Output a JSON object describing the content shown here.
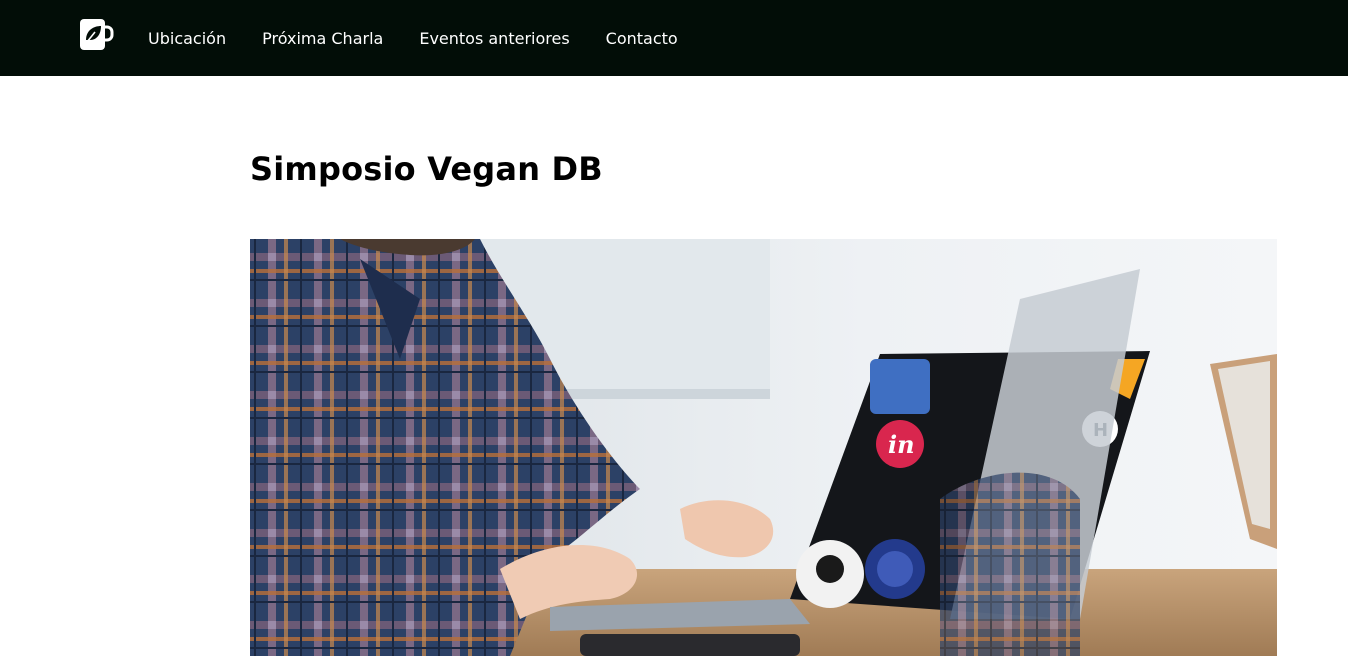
{
  "header": {
    "logo_icon": "vegan-mug-icon",
    "nav_items": [
      {
        "label": "Ubicación"
      },
      {
        "label": "Próxima Charla"
      },
      {
        "label": "Eventos anteriores"
      },
      {
        "label": "Contacto"
      }
    ],
    "background_color": "#020d07"
  },
  "main": {
    "title": "Simposio Vegan DB",
    "hero_image": {
      "sticker_text_in": "in",
      "sticker_text_h": "H"
    }
  }
}
